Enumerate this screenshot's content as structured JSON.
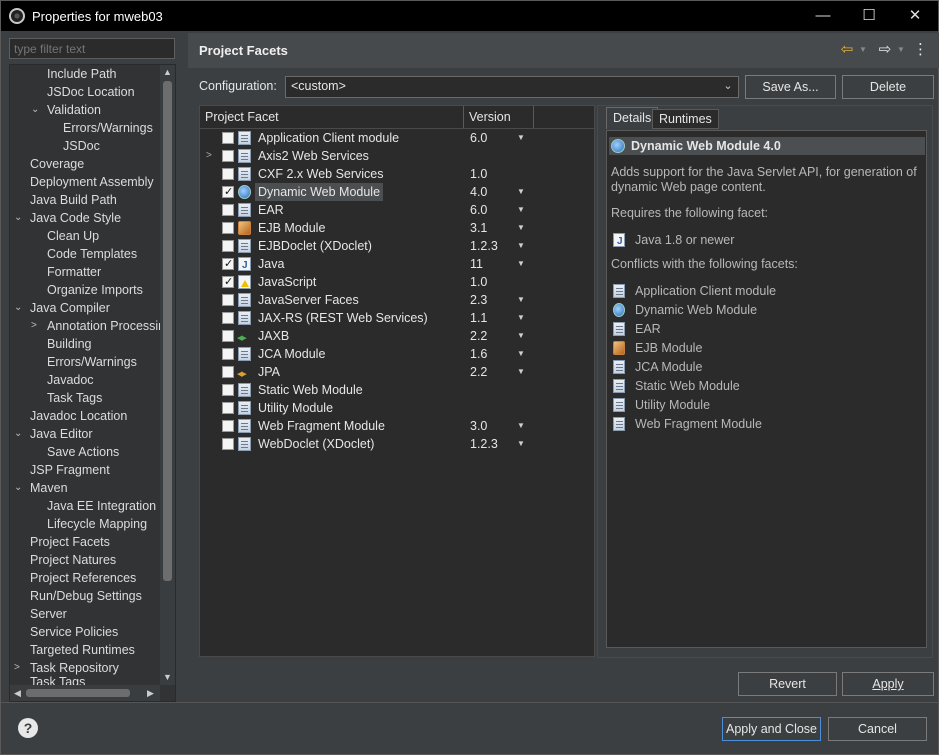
{
  "window": {
    "title": "Properties for mweb03",
    "minimize": "—",
    "maximize": "☐",
    "close": "✕"
  },
  "sidebar": {
    "filter_placeholder": "type filter text",
    "items": [
      {
        "label": "Include Path",
        "indent": 2
      },
      {
        "label": "JSDoc Location",
        "indent": 2
      },
      {
        "label": "Validation",
        "indent": 2,
        "twisty": "⌄"
      },
      {
        "label": "Errors/Warnings",
        "indent": 3
      },
      {
        "label": "JSDoc",
        "indent": 3
      },
      {
        "label": "Coverage",
        "indent": 1
      },
      {
        "label": "Deployment Assembly",
        "indent": 1
      },
      {
        "label": "Java Build Path",
        "indent": 1
      },
      {
        "label": "Java Code Style",
        "indent": 1,
        "twisty": "⌄"
      },
      {
        "label": "Clean Up",
        "indent": 2
      },
      {
        "label": "Code Templates",
        "indent": 2
      },
      {
        "label": "Formatter",
        "indent": 2
      },
      {
        "label": "Organize Imports",
        "indent": 2
      },
      {
        "label": "Java Compiler",
        "indent": 1,
        "twisty": "⌄"
      },
      {
        "label": "Annotation Processin",
        "indent": 2,
        "twisty": ">"
      },
      {
        "label": "Building",
        "indent": 2
      },
      {
        "label": "Errors/Warnings",
        "indent": 2
      },
      {
        "label": "Javadoc",
        "indent": 2
      },
      {
        "label": "Task Tags",
        "indent": 2
      },
      {
        "label": "Javadoc Location",
        "indent": 1
      },
      {
        "label": "Java Editor",
        "indent": 1,
        "twisty": "⌄"
      },
      {
        "label": "Save Actions",
        "indent": 2
      },
      {
        "label": "JSP Fragment",
        "indent": 1
      },
      {
        "label": "Maven",
        "indent": 1,
        "twisty": "⌄"
      },
      {
        "label": "Java EE Integration",
        "indent": 2
      },
      {
        "label": "Lifecycle Mapping",
        "indent": 2
      },
      {
        "label": "Project Facets",
        "indent": 1
      },
      {
        "label": "Project Natures",
        "indent": 1
      },
      {
        "label": "Project References",
        "indent": 1
      },
      {
        "label": "Run/Debug Settings",
        "indent": 1
      },
      {
        "label": "Server",
        "indent": 1
      },
      {
        "label": "Service Policies",
        "indent": 1
      },
      {
        "label": "Targeted Runtimes",
        "indent": 1
      },
      {
        "label": "Task Repository",
        "indent": 1,
        "twisty": ">"
      },
      {
        "label": "Task Tags",
        "indent": 1
      }
    ]
  },
  "page": {
    "title": "Project Facets",
    "back_icon": "⇦",
    "forward_icon": "⇨",
    "menu_icon": "⋮",
    "config_label": "Configuration:",
    "config_value": "<custom>",
    "save_as": "Save As...",
    "delete": "Delete",
    "col_facet": "Project Facet",
    "col_version": "Version",
    "facets": [
      {
        "label": "Application Client module",
        "version": "6.0",
        "checked": false,
        "icon": "doc",
        "dropdown": true
      },
      {
        "label": "Axis2 Web Services",
        "version": "",
        "checked": false,
        "icon": "doc",
        "twisty": true
      },
      {
        "label": "CXF 2.x Web Services",
        "version": "1.0",
        "checked": false,
        "icon": "doc"
      },
      {
        "label": "Dynamic Web Module",
        "version": "4.0",
        "checked": true,
        "icon": "web",
        "dropdown": true,
        "selected": true
      },
      {
        "label": "EAR",
        "version": "6.0",
        "checked": false,
        "icon": "doc",
        "dropdown": true
      },
      {
        "label": "EJB Module",
        "version": "3.1",
        "checked": false,
        "icon": "ejb",
        "dropdown": true
      },
      {
        "label": "EJBDoclet (XDoclet)",
        "version": "1.2.3",
        "checked": false,
        "icon": "doc",
        "dropdown": true
      },
      {
        "label": "Java",
        "version": "11",
        "checked": true,
        "icon": "java",
        "dropdown": true
      },
      {
        "label": "JavaScript",
        "version": "1.0",
        "checked": true,
        "icon": "js"
      },
      {
        "label": "JavaServer Faces",
        "version": "2.3",
        "checked": false,
        "icon": "doc",
        "dropdown": true
      },
      {
        "label": "JAX-RS (REST Web Services)",
        "version": "1.1",
        "checked": false,
        "icon": "doc",
        "dropdown": true
      },
      {
        "label": "JAXB",
        "version": "2.2",
        "checked": false,
        "icon": "jaxb",
        "dropdown": true
      },
      {
        "label": "JCA Module",
        "version": "1.6",
        "checked": false,
        "icon": "doc",
        "dropdown": true
      },
      {
        "label": "JPA",
        "version": "2.2",
        "checked": false,
        "icon": "jpa",
        "dropdown": true
      },
      {
        "label": "Static Web Module",
        "version": "",
        "checked": false,
        "icon": "doc"
      },
      {
        "label": "Utility Module",
        "version": "",
        "checked": false,
        "icon": "doc"
      },
      {
        "label": "Web Fragment Module",
        "version": "3.0",
        "checked": false,
        "icon": "doc",
        "dropdown": true
      },
      {
        "label": "WebDoclet (XDoclet)",
        "version": "1.2.3",
        "checked": false,
        "icon": "doc",
        "dropdown": true
      }
    ],
    "tab_details": "Details",
    "tab_runtimes": "Runtimes",
    "detail_title": "Dynamic Web Module 4.0",
    "detail_desc": "Adds support for the Java Servlet API, for generation of dynamic Web page content.",
    "requires_label": "Requires the following facet:",
    "requires": [
      {
        "label": "Java 1.8 or newer",
        "icon": "java"
      }
    ],
    "conflicts_label": "Conflicts with the following facets:",
    "conflicts": [
      {
        "label": "Application Client module",
        "icon": "doc"
      },
      {
        "label": "Dynamic Web Module",
        "icon": "web"
      },
      {
        "label": "EAR",
        "icon": "doc"
      },
      {
        "label": "EJB Module",
        "icon": "ejb"
      },
      {
        "label": "JCA Module",
        "icon": "doc"
      },
      {
        "label": "Static Web Module",
        "icon": "doc"
      },
      {
        "label": "Utility Module",
        "icon": "doc"
      },
      {
        "label": "Web Fragment Module",
        "icon": "doc"
      }
    ],
    "revert": "Revert",
    "apply": "Apply"
  },
  "footer": {
    "help": "?",
    "apply_close": "Apply and Close",
    "cancel": "Cancel"
  }
}
